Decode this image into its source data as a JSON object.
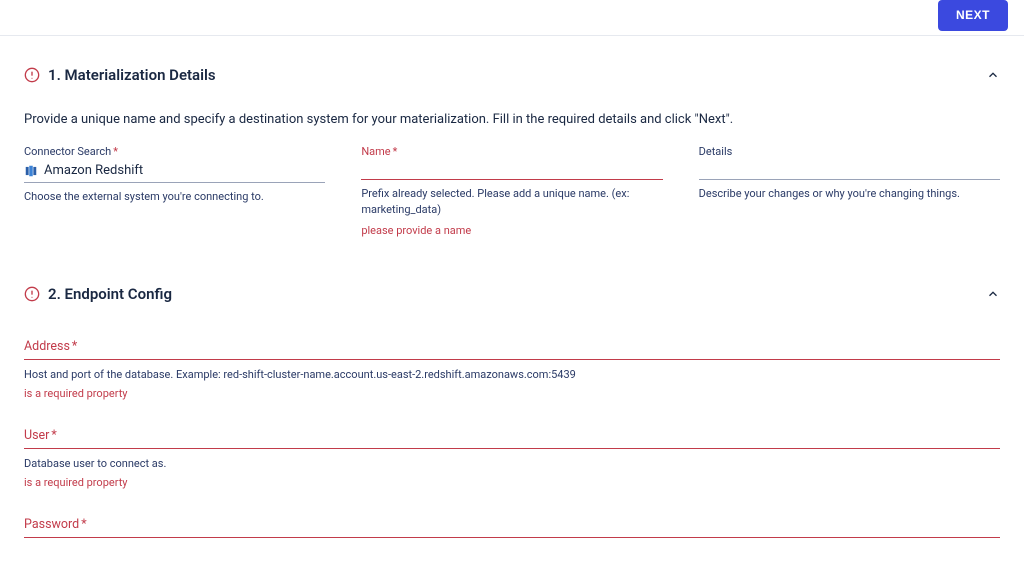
{
  "topbar": {
    "next_label": "NEXT"
  },
  "section1": {
    "title": "1. Materialization Details",
    "description": "Provide a unique name and specify a destination system for your materialization. Fill in the required details and click \"Next\"."
  },
  "connector": {
    "label": "Connector Search",
    "value": "Amazon Redshift",
    "help": "Choose the external system you're connecting to."
  },
  "name_field": {
    "label": "Name",
    "help": "Prefix already selected. Please add a unique name. (ex: marketing_data)",
    "error": "please provide a name"
  },
  "details_field": {
    "label": "Details",
    "help": "Describe your changes or why you're changing things."
  },
  "section2": {
    "title": "2. Endpoint Config"
  },
  "address": {
    "label": "Address",
    "help": "Host and port of the database. Example: red-shift-cluster-name.account.us-east-2.redshift.amazonaws.com:5439",
    "error": "is a required property"
  },
  "user": {
    "label": "User",
    "help": "Database user to connect as.",
    "error": "is a required property"
  },
  "password": {
    "label": "Password"
  }
}
